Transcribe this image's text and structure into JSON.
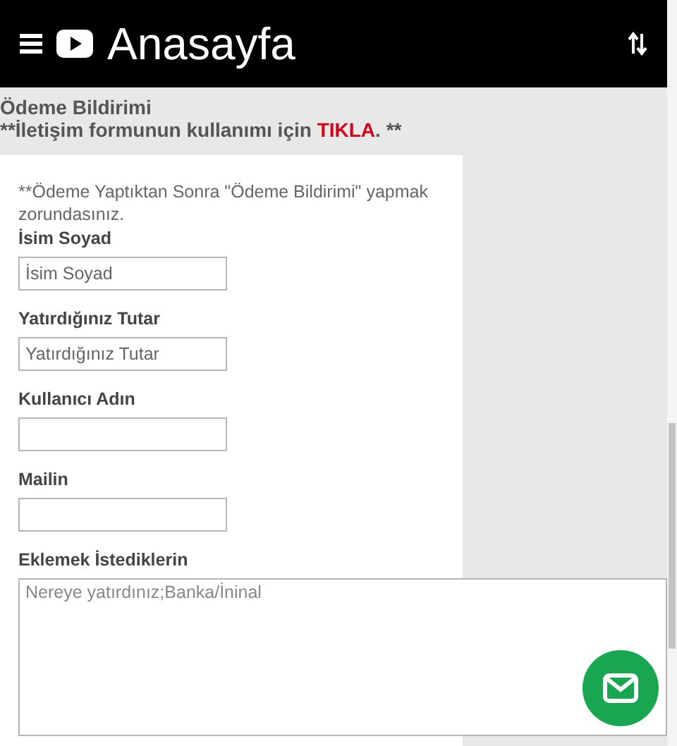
{
  "header": {
    "title": "Anasayfa"
  },
  "notice": {
    "title": "Ödeme Bildirimi",
    "line": "**İletişim formunun kullanımı için ",
    "link": "TIKLA",
    "line_end": ". **"
  },
  "form": {
    "intro": "**Ödeme Yaptıktan Sonra \"Ödeme Bildirimi\" yapmak zorundasınız.",
    "fields": [
      {
        "label": "İsim Soyad",
        "placeholder": "İsim Soyad"
      },
      {
        "label": "Yatırdığınız Tutar",
        "placeholder": "Yatırdığınız Tutar"
      },
      {
        "label": "Kullanıcı Adın"
      },
      {
        "label": "Mailin"
      }
    ],
    "message": {
      "label": "Eklemek İstediklerin",
      "placeholder": "Nereye yatırdınız;Banka/İninal"
    }
  }
}
